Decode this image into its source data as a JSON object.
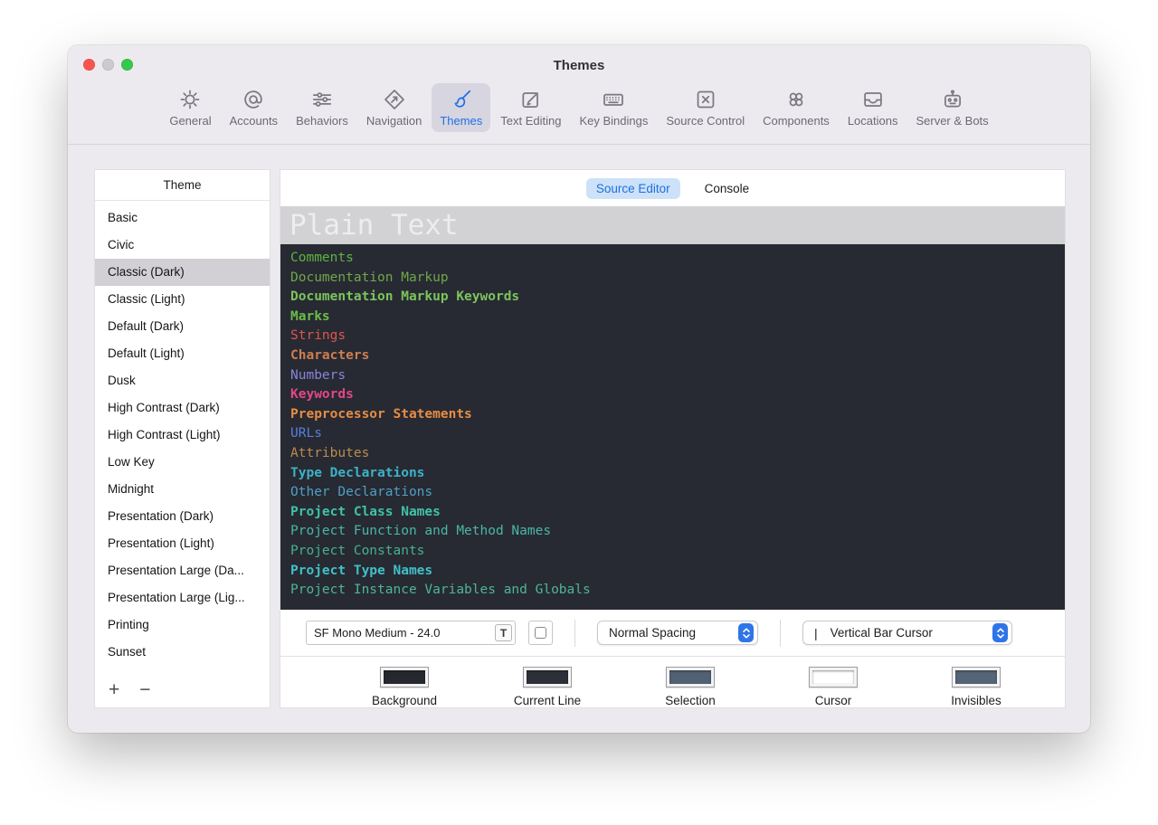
{
  "window": {
    "title": "Themes"
  },
  "traffic_lights": {
    "close": "#f8534e",
    "minimize": "#cdc9cd",
    "zoom": "#35c84b"
  },
  "toolbar": {
    "accent": "#2170e6",
    "items": [
      {
        "label": "General",
        "icon": "gear-icon",
        "selected": false
      },
      {
        "label": "Accounts",
        "icon": "at-icon",
        "selected": false
      },
      {
        "label": "Behaviors",
        "icon": "sliders-icon",
        "selected": false
      },
      {
        "label": "Navigation",
        "icon": "navigation-arrow-icon",
        "selected": false
      },
      {
        "label": "Themes",
        "icon": "paintbrush-icon",
        "selected": true
      },
      {
        "label": "Text Editing",
        "icon": "pencil-square-icon",
        "selected": false
      },
      {
        "label": "Key Bindings",
        "icon": "keyboard-icon",
        "selected": false
      },
      {
        "label": "Source Control",
        "icon": "source-control-icon",
        "selected": false
      },
      {
        "label": "Components",
        "icon": "components-icon",
        "selected": false
      },
      {
        "label": "Locations",
        "icon": "tray-icon",
        "selected": false
      },
      {
        "label": "Server & Bots",
        "icon": "robot-icon",
        "selected": false
      }
    ]
  },
  "sidebar": {
    "header": "Theme",
    "add_button": "+",
    "remove_button": "−",
    "items": [
      {
        "label": "Basic",
        "selected": false
      },
      {
        "label": "Civic",
        "selected": false
      },
      {
        "label": "Classic (Dark)",
        "selected": true
      },
      {
        "label": "Classic (Light)",
        "selected": false
      },
      {
        "label": "Default (Dark)",
        "selected": false
      },
      {
        "label": "Default (Light)",
        "selected": false
      },
      {
        "label": "Dusk",
        "selected": false
      },
      {
        "label": "High Contrast (Dark)",
        "selected": false
      },
      {
        "label": "High Contrast (Light)",
        "selected": false
      },
      {
        "label": "Low Key",
        "selected": false
      },
      {
        "label": "Midnight",
        "selected": false
      },
      {
        "label": "Presentation (Dark)",
        "selected": false
      },
      {
        "label": "Presentation (Light)",
        "selected": false
      },
      {
        "label": "Presentation Large (Da...",
        "selected": false
      },
      {
        "label": "Presentation Large (Lig...",
        "selected": false
      },
      {
        "label": "Printing",
        "selected": false
      },
      {
        "label": "Sunset",
        "selected": false
      }
    ]
  },
  "main": {
    "tabs": [
      {
        "label": "Source Editor",
        "selected": true
      },
      {
        "label": "Console",
        "selected": false
      }
    ],
    "preview": {
      "header": "Plain Text",
      "header_bg": "#d2d1d3",
      "header_color": "#eeedee",
      "editor_bg": "#272a32",
      "lines": [
        {
          "text": "Comments",
          "color": "#5fb342",
          "bold": false
        },
        {
          "text": "Documentation Markup",
          "color": "#70a74a",
          "bold": false
        },
        {
          "text": "Documentation Markup Keywords",
          "color": "#7cc45c",
          "bold": true
        },
        {
          "text": "Marks",
          "color": "#6cbb49",
          "bold": true
        },
        {
          "text": "Strings",
          "color": "#e1554d",
          "bold": false
        },
        {
          "text": "Characters",
          "color": "#cf7d52",
          "bold": true
        },
        {
          "text": "Numbers",
          "color": "#8b83d9",
          "bold": false
        },
        {
          "text": "Keywords",
          "color": "#e5458a",
          "bold": true
        },
        {
          "text": "Preprocessor Statements",
          "color": "#e88c43",
          "bold": true
        },
        {
          "text": "URLs",
          "color": "#5a7de0",
          "bold": false
        },
        {
          "text": "Attributes",
          "color": "#bd8b4f",
          "bold": false
        },
        {
          "text": "Type Declarations",
          "color": "#3db2c8",
          "bold": true
        },
        {
          "text": "Other Declarations",
          "color": "#509fc6",
          "bold": false
        },
        {
          "text": "Project Class Names",
          "color": "#40c2a9",
          "bold": true
        },
        {
          "text": "Project Function and Method Names",
          "color": "#4ab6a6",
          "bold": false
        },
        {
          "text": "Project Constants",
          "color": "#44b191",
          "bold": false
        },
        {
          "text": "Project Type Names",
          "color": "#40c1ca",
          "bold": true
        },
        {
          "text": "Project Instance Variables and Globals",
          "color": "#4cb698",
          "bold": false
        }
      ]
    },
    "controls": {
      "font_field": "SF Mono Medium - 24.0",
      "font_button": "T",
      "spacing_select": "Normal Spacing",
      "cursor_glyph": "|",
      "cursor_select": "Vertical Bar Cursor",
      "stepper_color": "#2f74e8"
    },
    "swatches": [
      {
        "label": "Background",
        "color": "#26282f"
      },
      {
        "label": "Current Line",
        "color": "#2d3039"
      },
      {
        "label": "Selection",
        "color": "#506273"
      },
      {
        "label": "Cursor",
        "color": "#ffffff"
      },
      {
        "label": "Invisibles",
        "color": "#546577"
      }
    ]
  }
}
